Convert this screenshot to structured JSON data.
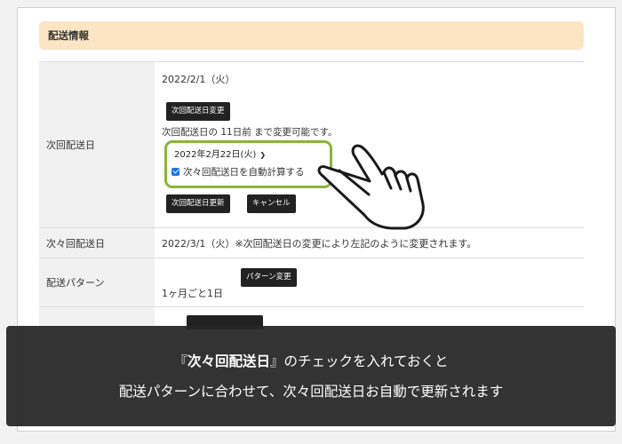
{
  "section": {
    "title": "配送情報"
  },
  "next_delivery": {
    "label": "次回配送日",
    "date": "2022/2/1（火）",
    "change_button": "次回配送日変更",
    "note": "次回配送日の 11日前 まで変更可能です。",
    "selected_date": "2022年2月22日(火)",
    "auto_calc_checkbox": {
      "label": "次々回配送日を自動計算する",
      "checked": true
    },
    "update_button": "次回配送日更新",
    "cancel_button": "キャンセル"
  },
  "next_next_delivery": {
    "label": "次々回配送日",
    "value": "2022/3/1（火）※次回配送日の変更により左記のように変更されます。"
  },
  "delivery_pattern": {
    "label": "配送パターン",
    "change_button": "パターン変更",
    "value": "1ヶ月ごと1日"
  },
  "caption": {
    "line1_prefix": "『",
    "line1_bold": "次々回配送日",
    "line1_suffix": "』のチェックを入れておくと",
    "line2": "配送パターンに合わせて、次々回配送日お自動で更新されます"
  },
  "colors": {
    "header_bg": "#fbe5c3",
    "highlight": "#8cb33a",
    "button_bg": "#222222",
    "overlay_bg": "#282828"
  }
}
